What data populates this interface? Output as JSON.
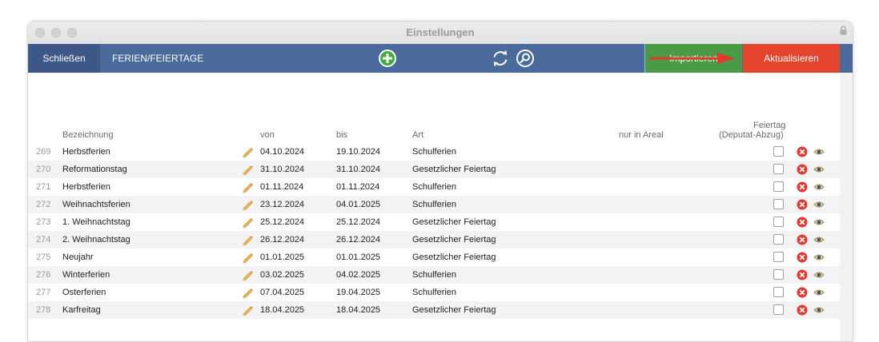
{
  "window": {
    "title": "Einstellungen"
  },
  "toolbar": {
    "close_label": "Schließen",
    "section_label": "FERIEN/FEIERTAGE",
    "import_label": "Importieren",
    "update_label": "Aktualisieren"
  },
  "table": {
    "headers": {
      "bezeichnung": "Bezeichnung",
      "von": "von",
      "bis": "bis",
      "art": "Art",
      "areal": "nur in Areal",
      "feiertag_line1": "Feiertag",
      "feiertag_line2": "(Deputat-Abzug)"
    },
    "rows": [
      {
        "id": "269",
        "name": "Herbstferien",
        "von": "04.10.2024",
        "bis": "19.10.2024",
        "art": "Schulferien"
      },
      {
        "id": "270",
        "name": "Reformationstag",
        "von": "31.10.2024",
        "bis": "31.10.2024",
        "art": "Gesetzlicher Feiertag"
      },
      {
        "id": "271",
        "name": "Herbstferien",
        "von": "01.11.2024",
        "bis": "01.11.2024",
        "art": "Schulferien"
      },
      {
        "id": "272",
        "name": "Weihnachtsferien",
        "von": "23.12.2024",
        "bis": "04.01.2025",
        "art": "Schulferien"
      },
      {
        "id": "273",
        "name": "1. Weihnachtstag",
        "von": "25.12.2024",
        "bis": "25.12.2024",
        "art": "Gesetzlicher Feiertag"
      },
      {
        "id": "274",
        "name": "2. Weihnachtstag",
        "von": "26.12.2024",
        "bis": "26.12.2024",
        "art": "Gesetzlicher Feiertag"
      },
      {
        "id": "275",
        "name": "Neujahr",
        "von": "01.01.2025",
        "bis": "01.01.2025",
        "art": "Gesetzlicher Feiertag"
      },
      {
        "id": "276",
        "name": "Winterferien",
        "von": "03.02.2025",
        "bis": "04.02.2025",
        "art": "Schulferien"
      },
      {
        "id": "277",
        "name": "Osterferien",
        "von": "07.04.2025",
        "bis": "19.04.2025",
        "art": "Schulferien"
      },
      {
        "id": "278",
        "name": "Karfreitag",
        "von": "18.04.2025",
        "bis": "18.04.2025",
        "art": "Gesetzlicher Feiertag"
      }
    ]
  },
  "colors": {
    "toolbar": "#4a6a9b",
    "close_button": "#3d5886",
    "import_button": "#4b9a45",
    "update_button": "#e5442d",
    "annotation_arrow": "#e03a2a"
  },
  "icons": {
    "add": "plus-circle-icon",
    "refresh": "refresh-icon",
    "search": "search-icon",
    "edit": "pencil-icon",
    "delete": "delete-icon",
    "view": "eye-icon",
    "lock": "lock-icon"
  }
}
